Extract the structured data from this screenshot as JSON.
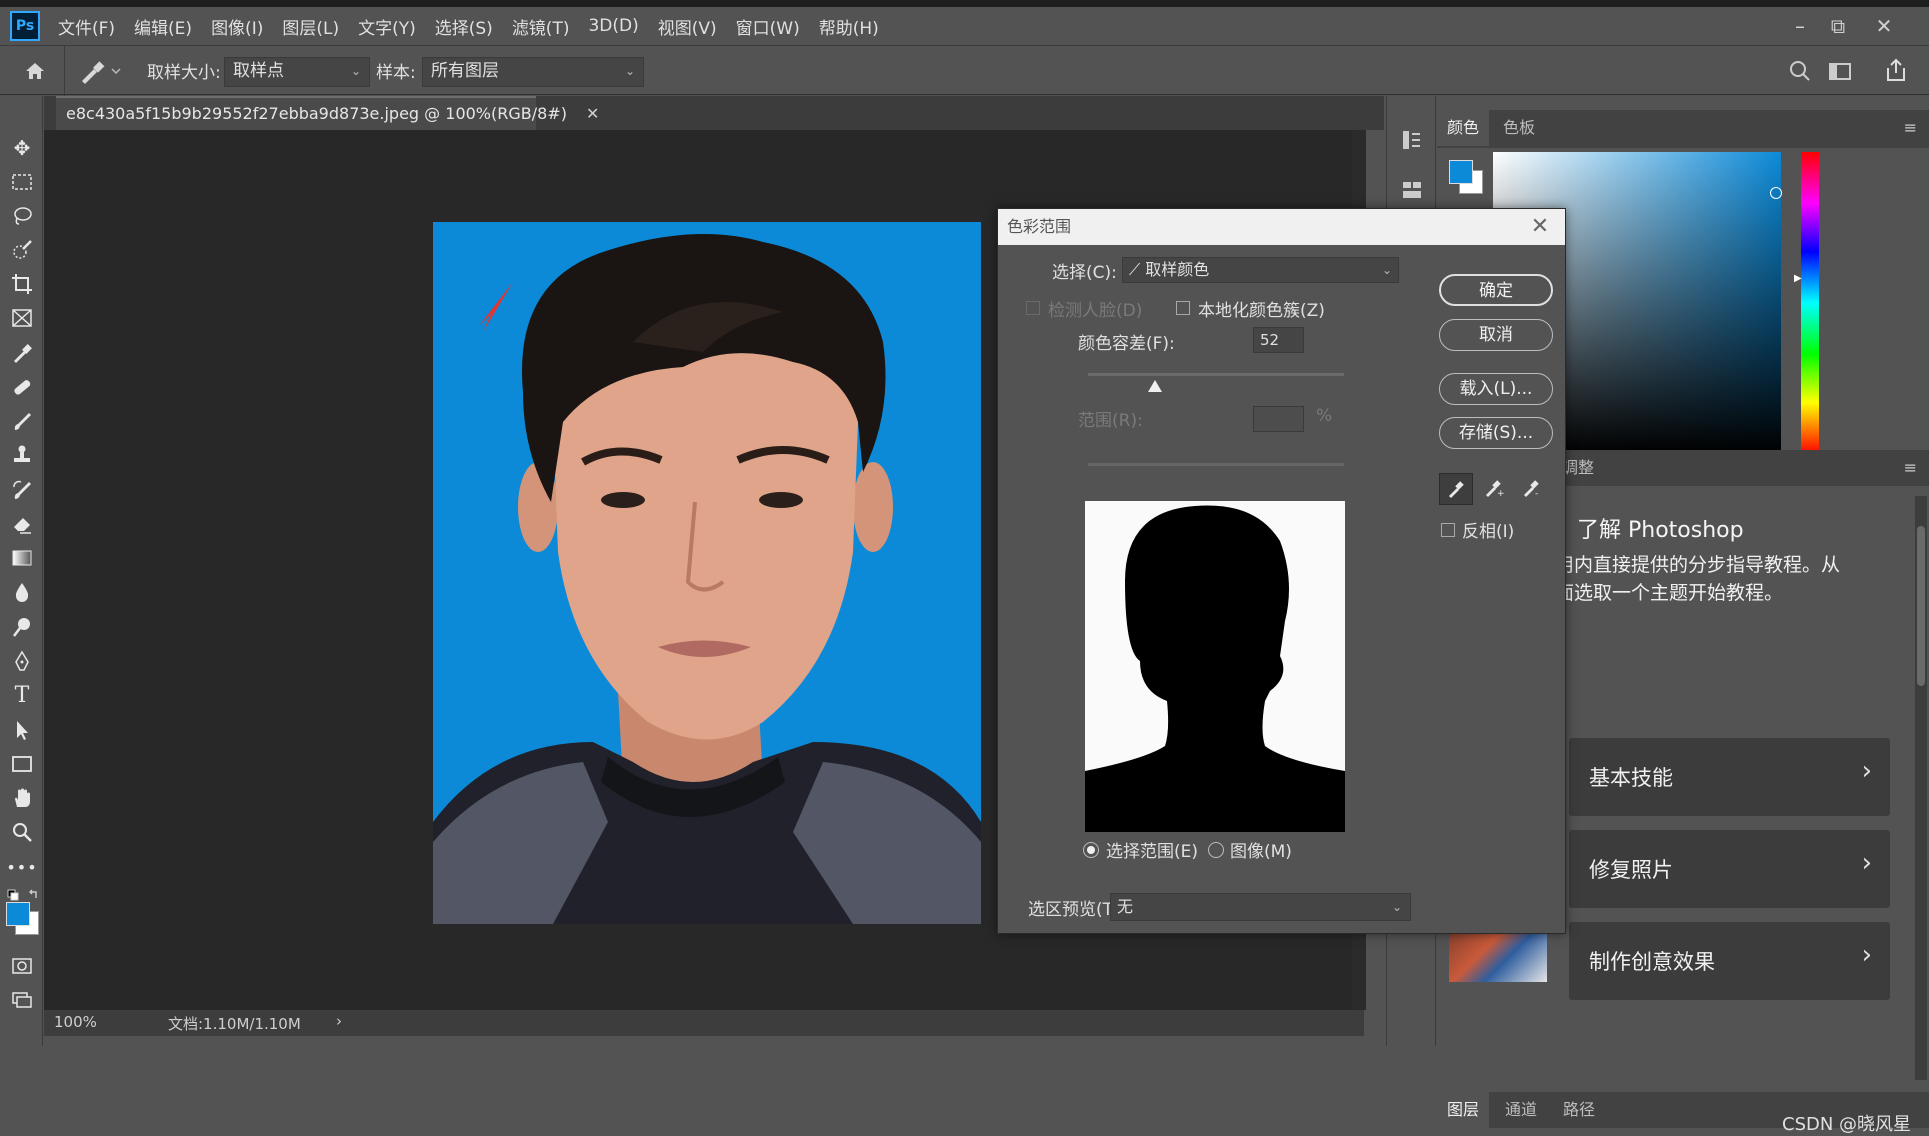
{
  "app": {
    "logo": "Ps"
  },
  "menu": [
    "文件(F)",
    "编辑(E)",
    "图像(I)",
    "图层(L)",
    "文字(Y)",
    "选择(S)",
    "滤镜(T)",
    "3D(D)",
    "视图(V)",
    "窗口(W)",
    "帮助(H)"
  ],
  "window_controls": {
    "minimize": "–",
    "restore": "⧉",
    "close": "✕"
  },
  "options": {
    "sample_size_label": "取样大小:",
    "sample_size_value": "取样点",
    "sample_label": "样本:",
    "sample_value": "所有图层"
  },
  "document": {
    "tab_title": "e8c430a5f15b9b29552f27ebba9d873e.jpeg @ 100%(RGB/8#)",
    "tab_close": "✕",
    "zoom": "100%",
    "doc_info": "文档:1.10M/1.10M",
    "status_arrow": "›"
  },
  "tools": [
    "move-icon",
    "marquee-icon",
    "lasso-icon",
    "quick-select-icon",
    "crop-icon",
    "frame-icon",
    "eyedropper-icon",
    "healing-icon",
    "brush-icon",
    "stamp-icon",
    "history-brush-icon",
    "eraser-icon",
    "gradient-icon",
    "blur-icon",
    "dodge-icon",
    "pen-icon",
    "type-icon",
    "path-select-icon",
    "rectangle-icon",
    "hand-icon",
    "zoom-icon",
    "more-icon"
  ],
  "colors": {
    "foreground": "#0c8ad8",
    "background": "#ffffff",
    "photo_bg": "#0c8ad8",
    "accent_blue": "#1d7fd6"
  },
  "color_panel": {
    "tabs": [
      "颜色",
      "色板"
    ],
    "active_tab": "颜色"
  },
  "learn_panel": {
    "tab_fragment": "调整",
    "title": "了解 Photoshop",
    "desc_line1": "用内直接提供的分步指导教程。从",
    "desc_line2": "面选取一个主题开始教程。",
    "cards": [
      "基本技能",
      "修复照片",
      "制作创意效果"
    ],
    "chevron": "›"
  },
  "bottom_panel_tabs": [
    "图层",
    "通道",
    "路径"
  ],
  "watermark": "CSDN @晓风星",
  "dialog": {
    "title": "色彩范围",
    "close": "✕",
    "select_label": "选择(C):",
    "select_value": "取样颜色",
    "detect_faces": "检测人脸(D)",
    "localized_clusters": "本地化颜色簇(Z)",
    "fuzziness_label": "颜色容差(F):",
    "fuzziness_value": "52",
    "fuzziness_fraction": 0.26,
    "range_label": "范围(R):",
    "range_unit": "%",
    "radio_selection": "选择范围(E)",
    "radio_image": "图像(M)",
    "preview_label": "选区预览(T):",
    "preview_value": "无",
    "ok": "确定",
    "cancel": "取消",
    "load": "载入(L)...",
    "save": "存储(S)...",
    "invert": "反相(I)"
  }
}
